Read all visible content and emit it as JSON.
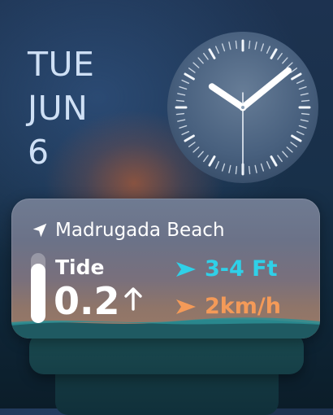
{
  "date": {
    "weekday": "TUE",
    "month": "JUN",
    "day": "6"
  },
  "clock": {
    "hour": 10,
    "minute": 8,
    "second": 30
  },
  "tide_widget": {
    "location": "Madrugada Beach",
    "location_icon": "navigation-arrow-icon",
    "tide_label": "Tide",
    "tide_value": "0.2",
    "tide_trend_icon": "arrow-up-icon",
    "tide_level_fraction": 0.85,
    "swell": {
      "value": "3-4 Ft",
      "icon": "swell-direction-icon",
      "color": "#2fd0e8"
    },
    "wind": {
      "value": "2km/h",
      "icon": "wind-direction-icon",
      "color": "#f49a58"
    }
  }
}
